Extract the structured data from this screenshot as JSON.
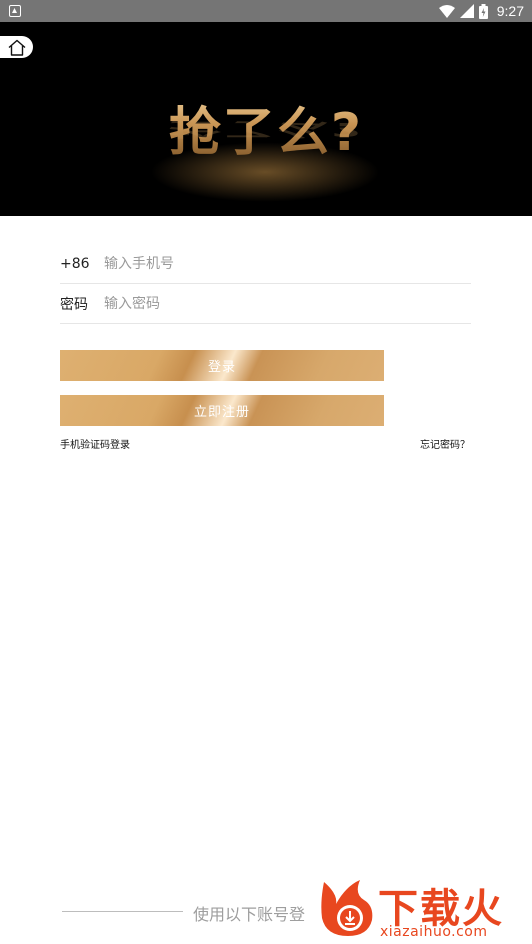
{
  "status_bar": {
    "time": "9:27",
    "icons": [
      "notification-icon",
      "wifi-icon",
      "signal-icon",
      "battery-icon"
    ]
  },
  "banner": {
    "logo_text": "抢了么?",
    "home_icon": "home-icon"
  },
  "login_form": {
    "phone": {
      "prefix": "+86",
      "placeholder": "输入手机号",
      "value": ""
    },
    "password": {
      "label": "密码",
      "placeholder": "输入密码",
      "value": ""
    },
    "login_label": "登录",
    "register_label": "立即注册",
    "sms_login_link": "手机验证码登录",
    "forgot_password_link": "忘记密码？"
  },
  "third_party": {
    "label": "使用以下账号登"
  },
  "watermark": {
    "title": "下载火",
    "url": "xiazaihuo.com",
    "color": "#e8471f"
  },
  "colors": {
    "gold": "#d9a866",
    "status_bar": "#757575"
  }
}
